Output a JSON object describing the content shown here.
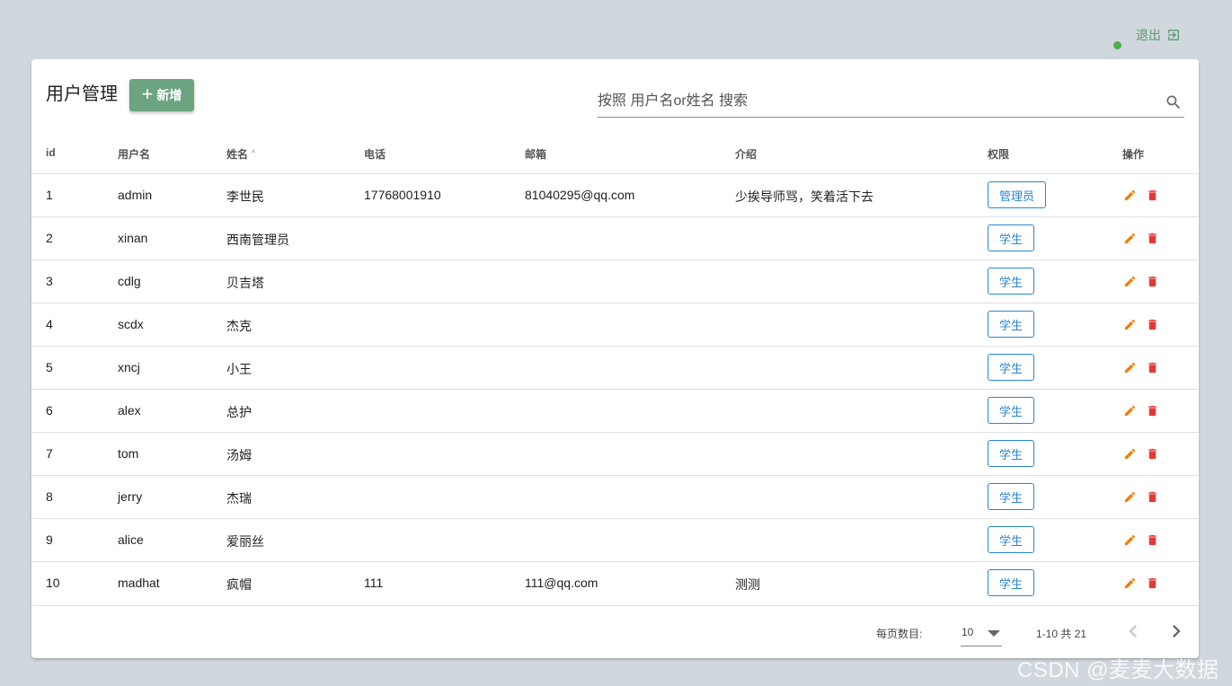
{
  "header": {
    "logout_label": "退出",
    "status_color": "#4caf50"
  },
  "card": {
    "title": "用户管理",
    "add_label": "新增",
    "search_placeholder": "按照 用户名or姓名 搜索"
  },
  "table": {
    "columns": [
      "id",
      "用户名",
      "姓名",
      "电话",
      "邮箱",
      "介绍",
      "权限",
      "操作"
    ],
    "rows": [
      {
        "id": "1",
        "username": "admin",
        "name": "李世民",
        "phone": "17768001910",
        "email": "81040295@qq.com",
        "intro": "少挨导师骂，笑着活下去",
        "role": "管理员"
      },
      {
        "id": "2",
        "username": "xinan",
        "name": "西南管理员",
        "phone": "",
        "email": "",
        "intro": "",
        "role": "学生"
      },
      {
        "id": "3",
        "username": "cdlg",
        "name": "贝吉塔",
        "phone": "",
        "email": "",
        "intro": "",
        "role": "学生"
      },
      {
        "id": "4",
        "username": "scdx",
        "name": "杰克",
        "phone": "",
        "email": "",
        "intro": "",
        "role": "学生"
      },
      {
        "id": "5",
        "username": "xncj",
        "name": "小王",
        "phone": "",
        "email": "",
        "intro": "",
        "role": "学生"
      },
      {
        "id": "6",
        "username": "alex",
        "name": "总护",
        "phone": "",
        "email": "",
        "intro": "",
        "role": "学生"
      },
      {
        "id": "7",
        "username": "tom",
        "name": "汤姆",
        "phone": "",
        "email": "",
        "intro": "",
        "role": "学生"
      },
      {
        "id": "8",
        "username": "jerry",
        "name": "杰瑞",
        "phone": "",
        "email": "",
        "intro": "",
        "role": "学生"
      },
      {
        "id": "9",
        "username": "alice",
        "name": "爱丽丝",
        "phone": "",
        "email": "",
        "intro": "",
        "role": "学生"
      },
      {
        "id": "10",
        "username": "madhat",
        "name": "疯帽",
        "phone": "111",
        "email": "111@qq.com",
        "intro": "测测",
        "role": "学生"
      }
    ]
  },
  "pagination": {
    "per_page_label": "每页数目:",
    "per_page_value": "10",
    "range_label": "1-10 共 21"
  },
  "watermark": "CSDN @麦麦大数据",
  "colors": {
    "accent_green": "#6ca481",
    "role_blue": "#2a86d0",
    "edit_orange": "#f57c00",
    "delete_red": "#e53935",
    "background": "#d0d7dd"
  },
  "icons": {
    "logout": "logout-icon",
    "add": "plus-icon",
    "search": "search-icon",
    "edit": "pencil-icon",
    "delete": "trash-icon",
    "prev": "chevron-left-icon",
    "next": "chevron-right-icon"
  }
}
